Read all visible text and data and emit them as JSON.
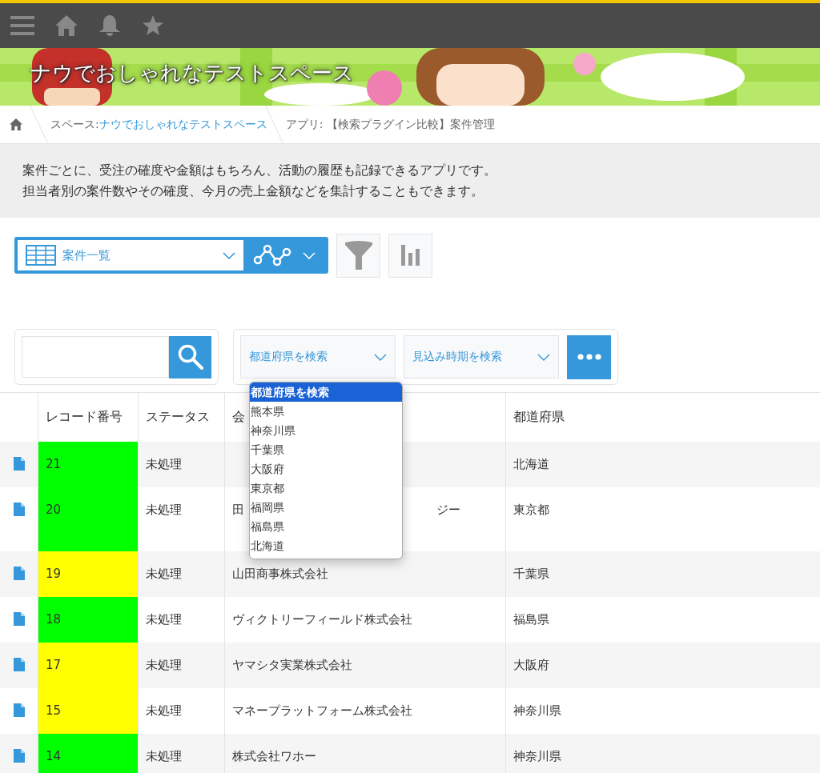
{
  "space_title": "ナウでおしゃれなテストスペース",
  "breadcrumb": {
    "space_label": "スペース: ",
    "space_link": "ナウでおしゃれなテストスペース",
    "app": "アプリ: 【検索プラグイン比較】案件管理"
  },
  "description": [
    "案件ごとに、受注の確度や金額はもちろん、活動の履歴も記録できるアプリです。",
    "担当者別の案件数やその確度、今月の売上金額などを集計することもできます。"
  ],
  "view_select": {
    "value": "案件一覧"
  },
  "filters": [
    {
      "label": "都道府県を検索"
    },
    {
      "label": "見込み時期を検索"
    }
  ],
  "dropdown": {
    "options": [
      {
        "label": "都道府県を検索",
        "selected": true
      },
      {
        "label": "熊本県",
        "selected": false
      },
      {
        "label": "神奈川県",
        "selected": false
      },
      {
        "label": "千葉県",
        "selected": false
      },
      {
        "label": "大阪府",
        "selected": false
      },
      {
        "label": "東京都",
        "selected": false
      },
      {
        "label": "福岡県",
        "selected": false
      },
      {
        "label": "福島県",
        "selected": false
      },
      {
        "label": "北海道",
        "selected": false
      }
    ]
  },
  "table": {
    "columns": [
      "レコード番号",
      "ステータス",
      "会",
      "都道府県"
    ],
    "rows": [
      {
        "record": "21",
        "color": "#00ff00",
        "status": "未処理",
        "prefecture": "北海道",
        "tall": false
      },
      {
        "record": "20",
        "color": "#00ff00",
        "status": "未処理",
        "company": "田",
        "company_tail": "ジー",
        "prefecture": "東京都",
        "tall": true
      },
      {
        "record": "19",
        "color": "#ffff00",
        "status": "未処理",
        "company": "山田商事株式会社",
        "prefecture": "千葉県",
        "tall": false
      },
      {
        "record": "18",
        "color": "#00ff00",
        "status": "未処理",
        "company": "ヴィクトリーフィールド株式会社",
        "prefecture": "福島県",
        "tall": false
      },
      {
        "record": "17",
        "color": "#ffff00",
        "status": "未処理",
        "company": "ヤマシタ実業株式会社",
        "prefecture": "大阪府",
        "tall": false
      },
      {
        "record": "15",
        "color": "#ffff00",
        "status": "未処理",
        "company": "マネープラットフォーム株式会社",
        "prefecture": "神奈川県",
        "tall": false
      },
      {
        "record": "14",
        "color": "#00ff00",
        "status": "未処理",
        "company": "株式会社ワホー",
        "prefecture": "神奈川県",
        "tall": false
      }
    ]
  }
}
